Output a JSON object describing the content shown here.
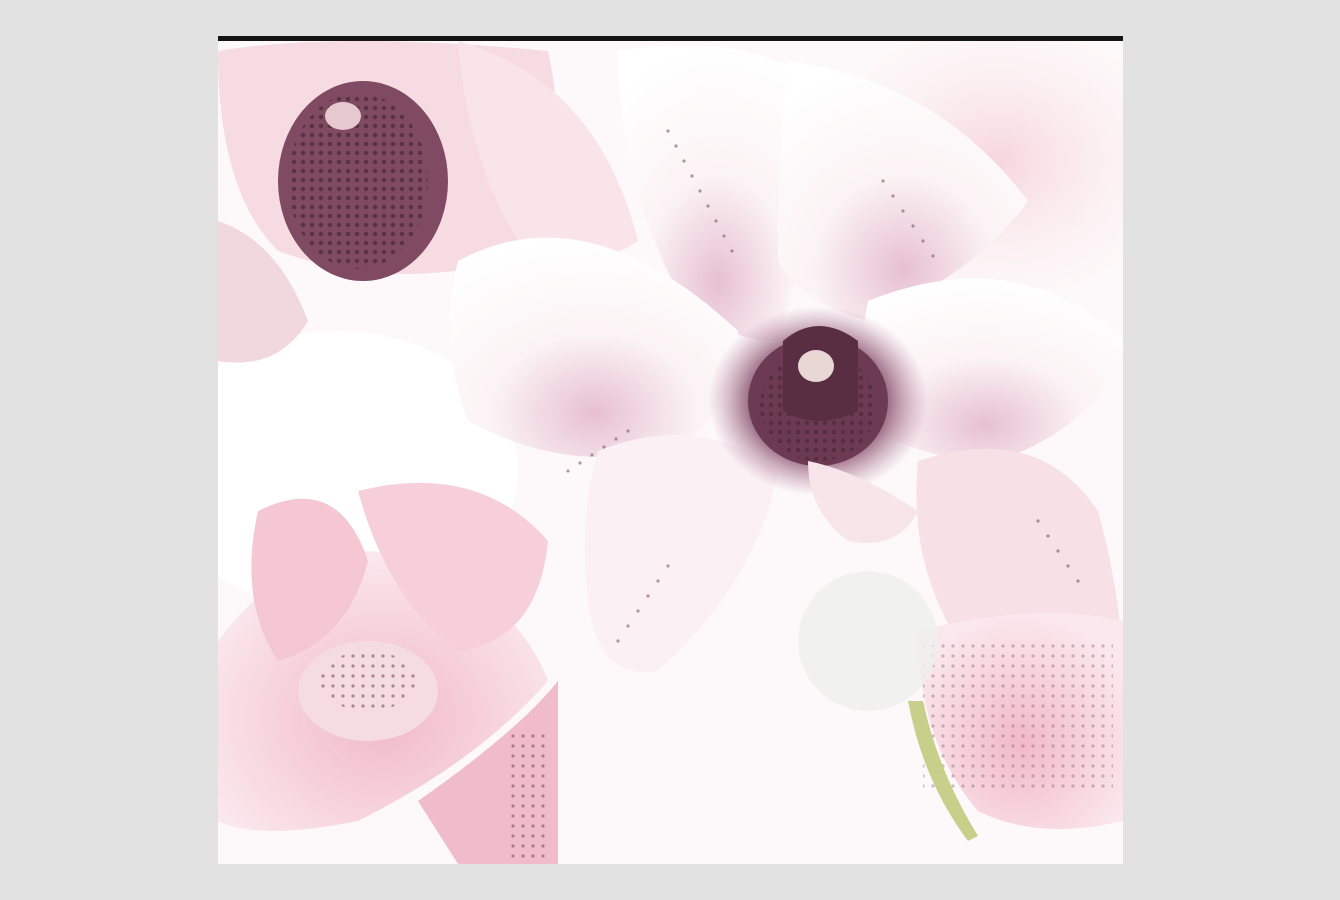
{
  "viewer": {
    "background_color": "#e2e2e2",
    "frame_bar_color": "#151515"
  },
  "photo": {
    "subject": "orchid-flowers",
    "palette": {
      "petal_white": "#fdf8f8",
      "petal_pink": "#f3c4cf",
      "center_dark": "#6e3d55",
      "center_mid": "#8f5370",
      "stem_green": "#c8cf8a"
    }
  }
}
